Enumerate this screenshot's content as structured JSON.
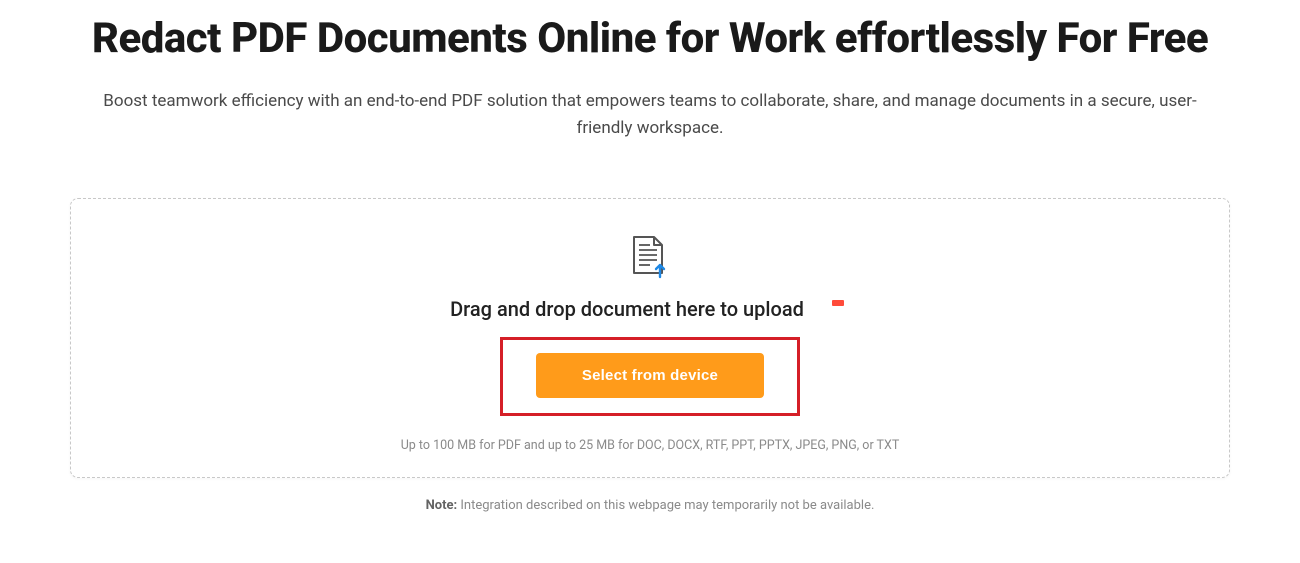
{
  "hero": {
    "title": "Redact PDF Documents Online for Work effortlessly For Free",
    "subtitle": "Boost teamwork efficiency with an end-to-end PDF solution that empowers teams to collaborate, share, and manage documents in a secure, user-friendly workspace."
  },
  "upload": {
    "drop_text": "Drag and drop document here to upload",
    "button_label": "Select from device",
    "limits": "Up to 100 MB for PDF and up to 25 MB for DOC, DOCX, RTF, PPT, PPTX, JPEG, PNG, or TXT"
  },
  "note": {
    "label": "Note:",
    "text": " Integration described on this webpage may temporarily not be available."
  }
}
